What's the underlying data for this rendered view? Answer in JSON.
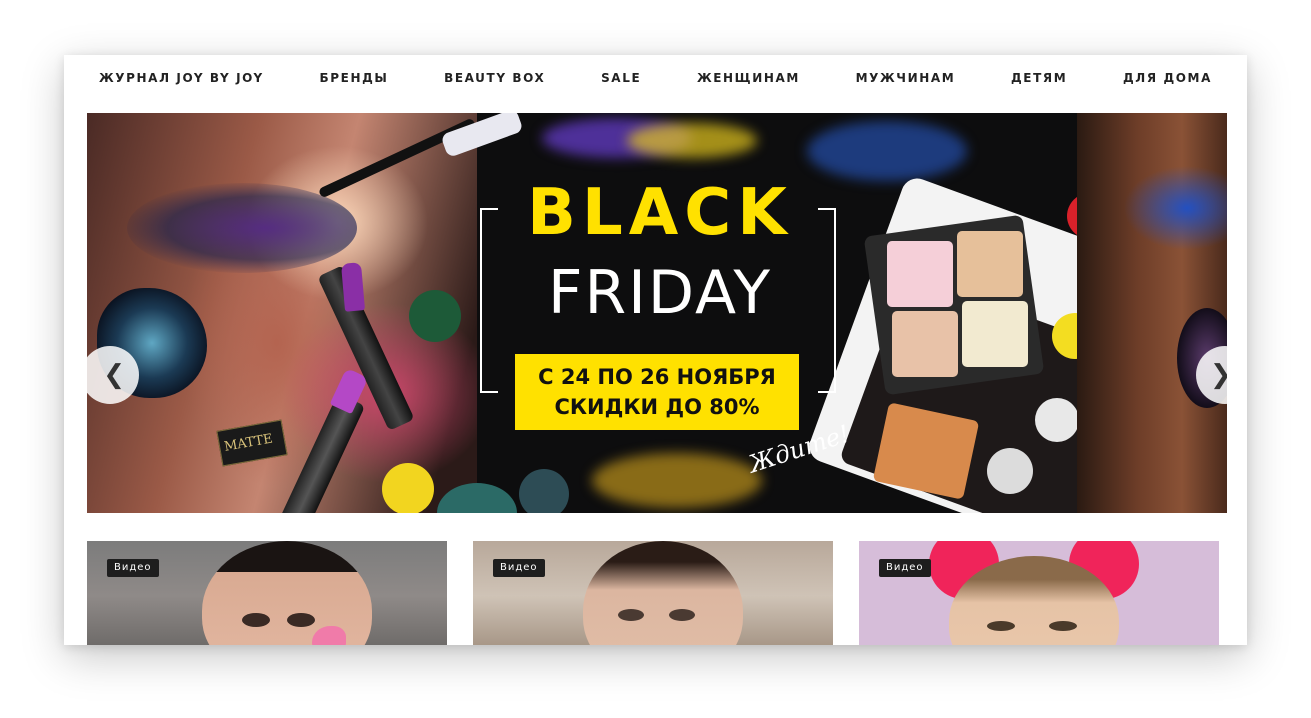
{
  "nav": {
    "items": [
      "ЖУРНАЛ JOY BY JOY",
      "БРЕНДЫ",
      "BEAUTY BOX",
      "SALE",
      "ЖЕНЩИНАМ",
      "МУЖЧИНАМ",
      "ДЕТЯМ",
      "ДЛЯ ДОМА"
    ]
  },
  "banner": {
    "title_1": "BLACK",
    "title_2": "FRIDAY",
    "date_line": "С 24 ПО 26 НОЯБРЯ",
    "discount_line": "СКИДКИ ДО 80%",
    "tagline": "Ждите!",
    "product_label": "MATTE",
    "prev_icon": "chevron-left-icon",
    "next_icon": "chevron-right-icon"
  },
  "cards": [
    {
      "badge": "Видео"
    },
    {
      "badge": "Видео"
    },
    {
      "badge": "Видео"
    }
  ],
  "colors": {
    "accent_yellow": "#ffe100",
    "banner_bg": "#0d0d0e",
    "nav_text": "#222222"
  }
}
